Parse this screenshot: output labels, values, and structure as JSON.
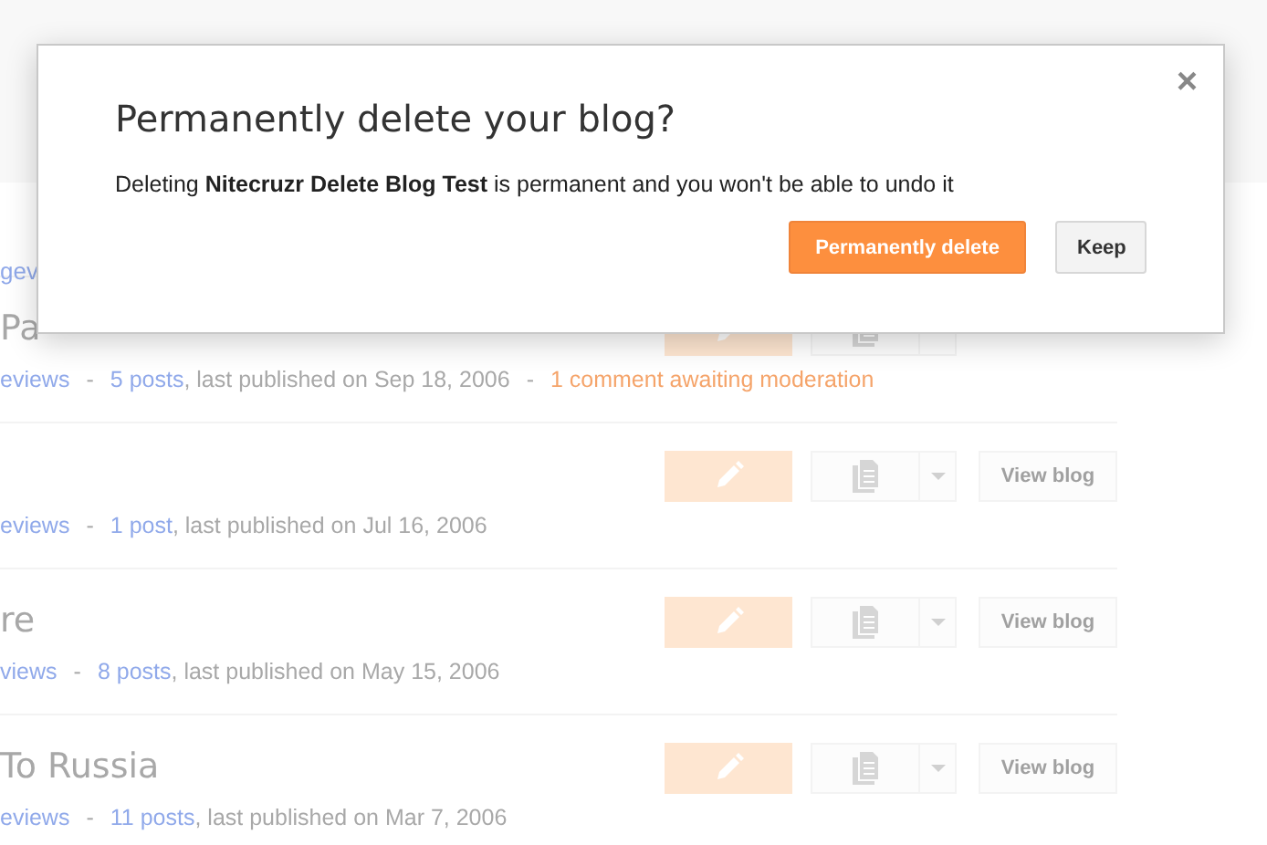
{
  "background": {
    "cut_link": "gev",
    "blogs": [
      {
        "title": "Pa",
        "meta": [
          {
            "kind": "link",
            "text": "eviews"
          },
          {
            "kind": "sep",
            "text": "-"
          },
          {
            "kind": "link",
            "text": "5 posts"
          },
          {
            "kind": "text",
            "text": ", last published on Sep 18, 2006"
          },
          {
            "kind": "sep",
            "text": "-"
          },
          {
            "kind": "alert",
            "text": "1 comment awaiting moderation"
          }
        ]
      },
      {
        "meta": [
          {
            "kind": "link",
            "text": "eviews"
          },
          {
            "kind": "sep",
            "text": "-"
          },
          {
            "kind": "link",
            "text": "1 post"
          },
          {
            "kind": "text",
            "text": ", last published on Jul 16, 2006"
          }
        ],
        "view_button": "View blog"
      },
      {
        "title": "re",
        "meta": [
          {
            "kind": "link",
            "text": "views"
          },
          {
            "kind": "sep",
            "text": "-"
          },
          {
            "kind": "link",
            "text": "8 posts"
          },
          {
            "kind": "text",
            "text": ", last published on May 15, 2006"
          }
        ],
        "view_button": "View blog"
      },
      {
        "title": "To Russia",
        "meta": [
          {
            "kind": "link",
            "text": "eviews"
          },
          {
            "kind": "sep",
            "text": "-"
          },
          {
            "kind": "link",
            "text": "11 posts"
          },
          {
            "kind": "text",
            "text": ", last published on Mar 7, 2006"
          }
        ],
        "view_button": "View blog"
      }
    ]
  },
  "dialog": {
    "title": "Permanently delete your blog?",
    "message": "Deleting **Nitecruzr Delete Blog Test** is permanent and you won't be able to undo it",
    "close": "×",
    "buttons": [
      {
        "label": "Permanently delete",
        "kind": "primary"
      },
      {
        "label": "Keep",
        "kind": "secondary"
      }
    ]
  }
}
